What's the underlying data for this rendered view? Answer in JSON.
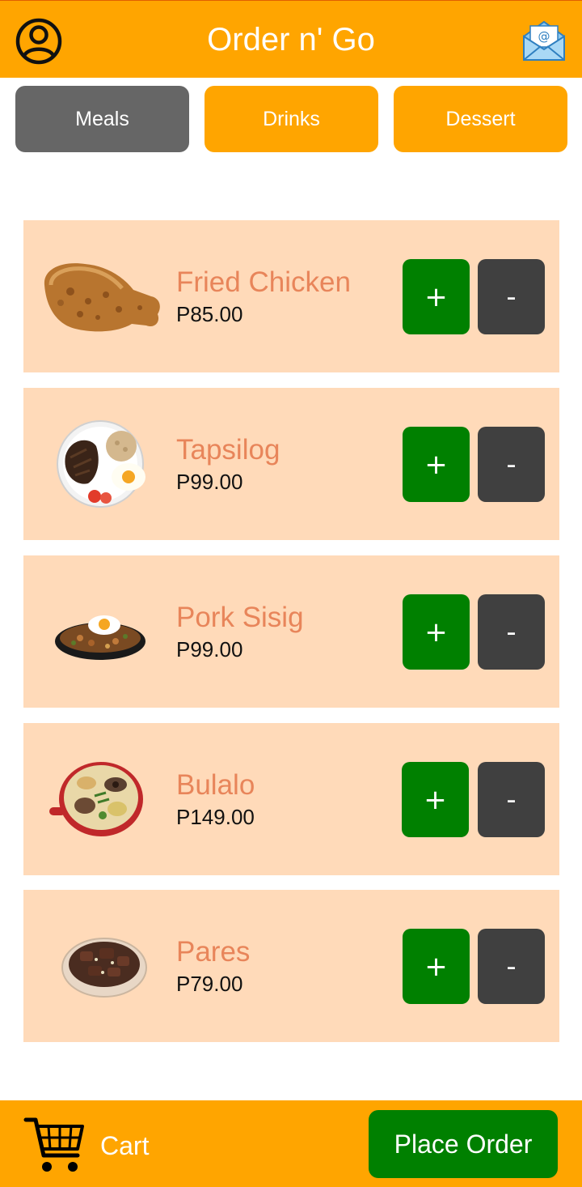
{
  "header": {
    "title": "Order n' Go",
    "profile_icon": "user-circle-icon",
    "mail_icon": "envelope-at-icon"
  },
  "categories": [
    {
      "label": "Meals",
      "active": true
    },
    {
      "label": "Drinks",
      "active": false
    },
    {
      "label": "Dessert",
      "active": false
    }
  ],
  "menu_items": [
    {
      "name": "Fried Chicken",
      "price": "P85.00",
      "image": "fried-chicken",
      "add_label": "+",
      "remove_label": "-"
    },
    {
      "name": "Tapsilog",
      "price": "P99.00",
      "image": "tapsilog-plate",
      "add_label": "+",
      "remove_label": "-"
    },
    {
      "name": "Pork Sisig",
      "price": "P99.00",
      "image": "sisig-sizzling-plate",
      "add_label": "+",
      "remove_label": "-"
    },
    {
      "name": "Bulalo",
      "price": "P149.00",
      "image": "bulalo-pot",
      "add_label": "+",
      "remove_label": "-"
    },
    {
      "name": "Pares",
      "price": "P79.00",
      "image": "pares-bowl",
      "add_label": "+",
      "remove_label": "-"
    }
  ],
  "footer": {
    "cart_label": "Cart",
    "cart_icon": "shopping-cart-icon",
    "place_order_label": "Place Order"
  },
  "colors": {
    "brand_orange": "#FFA500",
    "card_bg": "#FFDAB9",
    "add_green": "#008000",
    "remove_gray": "#404040",
    "active_tab": "#666666",
    "item_name": "#E8855A"
  }
}
